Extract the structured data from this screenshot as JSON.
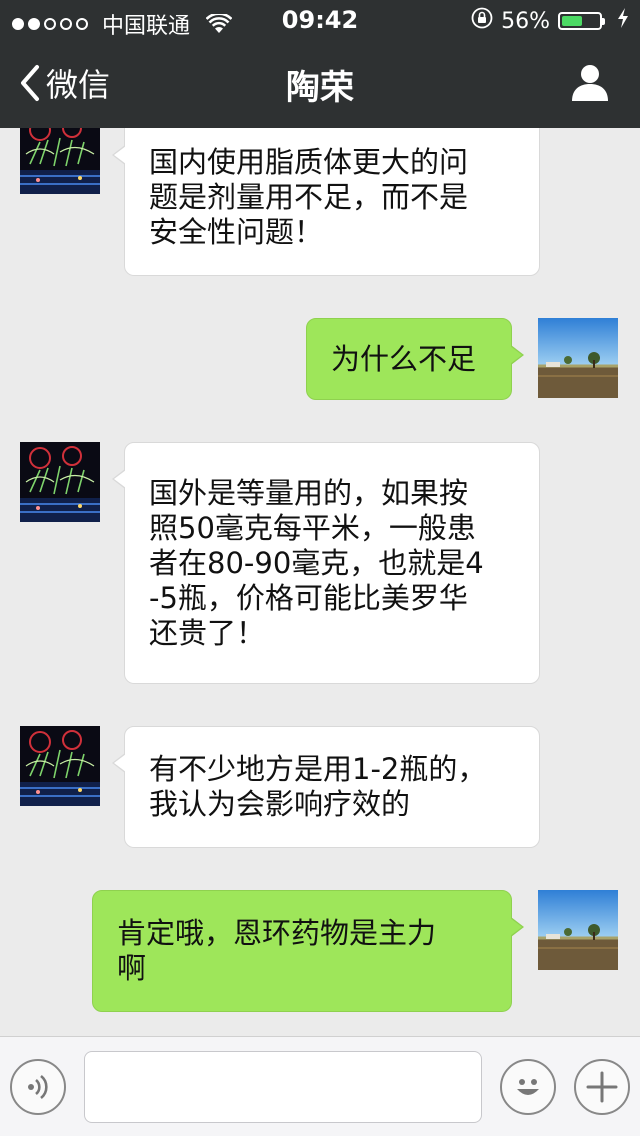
{
  "status_bar": {
    "carrier": "中国联通",
    "time": "09:42",
    "battery_percent": "56%",
    "battery_level": 0.56,
    "signal_bars_filled": 2,
    "signal_bars_total": 5
  },
  "nav": {
    "back_label": "微信",
    "title": "陶荣"
  },
  "messages": [
    {
      "side": "in",
      "lines": [
        "国内使用脂质体更大的问",
        "题是剂量用不足，而不是",
        "安全性问题！"
      ]
    },
    {
      "side": "out",
      "lines": [
        "为什么不足"
      ]
    },
    {
      "side": "in",
      "lines": [
        "国外是等量用的，如果按",
        "照50毫克每平米，一般患",
        "者在80-90毫克，也就是4",
        "-5瓶，价格可能比美罗华",
        "还贵了！"
      ]
    },
    {
      "side": "in",
      "lines": [
        "有不少地方是用1-2瓶的，",
        "我认为会影响疗效的"
      ]
    },
    {
      "side": "out",
      "lines": [
        "肯定哦，恩环药物是主力",
        "啊"
      ]
    }
  ],
  "colors": {
    "nav_bg": "#2e3132",
    "chat_bg": "#ebebeb",
    "bubble_out": "#9ee65a",
    "bubble_in": "#ffffff",
    "battery_fill": "#4cd964"
  },
  "icons": {
    "back": "chevron-left-icon",
    "profile": "person-icon",
    "voice": "voice-icon",
    "emoji": "emoji-icon",
    "more": "plus-icon",
    "wifi": "wifi-icon",
    "lock": "rotation-lock-icon",
    "charge": "charging-icon"
  }
}
